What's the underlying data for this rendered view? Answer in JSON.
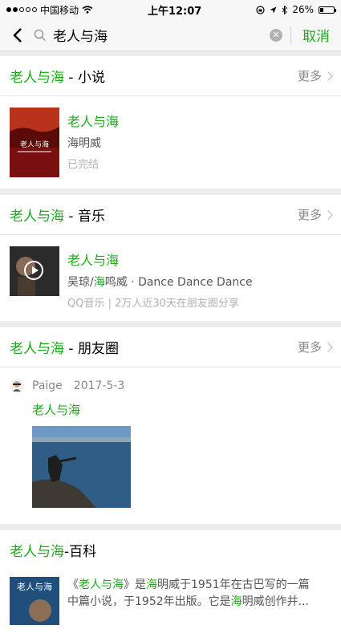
{
  "status": {
    "carrier": "中国移动",
    "time": "上午12:07",
    "battery": "26%",
    "battery_level": 0.26
  },
  "search": {
    "query": "老人与海",
    "cancel": "取消"
  },
  "novel": {
    "title_hl": "老人与海",
    "title_rest": " - 小说",
    "more": "更多",
    "item_title": "老人与海",
    "author": "海明威",
    "status": "已完结"
  },
  "music": {
    "title_hl": "老人与海",
    "title_rest": " - 音乐",
    "more": "更多",
    "item_title": "老人与海",
    "artist_a": "吴琼/",
    "artist_hl": "海",
    "artist_b": "鸣威 · Dance Dance Dance",
    "meta": "QQ音乐 | 2万人近30天在朋友圈分享"
  },
  "moments": {
    "title_hl": "老人与海",
    "title_rest": " - 朋友圈",
    "more": "更多",
    "user": "Paige",
    "date": "2017-5-3",
    "text": "老人与海"
  },
  "baike": {
    "title_hl": "老人与海",
    "title_rest": "-百科",
    "line1_a": "《",
    "line1_hl": "老人与海",
    "line1_b": "》是",
    "line1_hl2": "海",
    "line1_c": "明威于1951年在古巴写的一篇",
    "line2_a": "中篇小说，于1952年出版。它是",
    "line2_hl": "海",
    "line2_b": "明威创作并..."
  },
  "colors": {
    "accent": "#1aad19"
  }
}
